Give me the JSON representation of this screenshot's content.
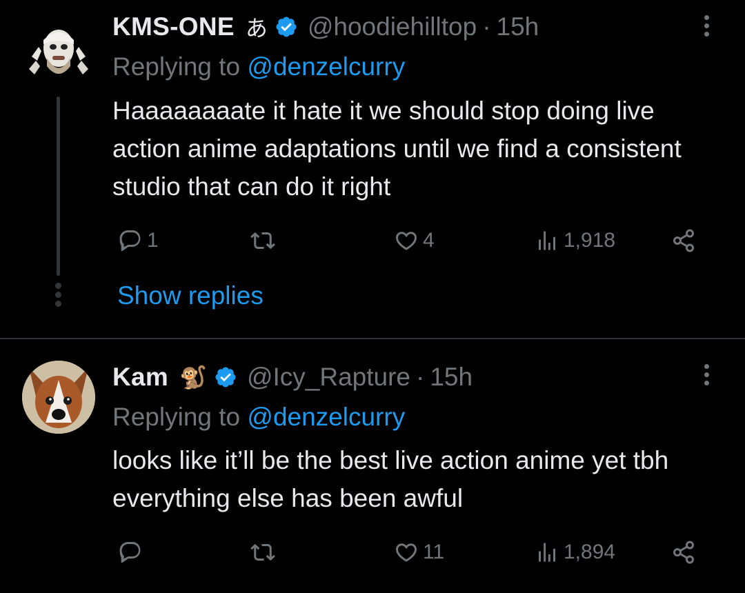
{
  "tweets": [
    {
      "name": "KMS-ONE",
      "name_emoji": "あ",
      "handle": "@hoodiehilltop",
      "separator": "·",
      "time": "15h",
      "replying_prefix": "Replying to ",
      "replying_mention": "@denzelcurry",
      "text": "Haaaaaaaate it hate it we should stop doing live action anime adaptations until we find a consistent studio that can do it right",
      "reply_count": "1",
      "retweet_count": "",
      "like_count": "4",
      "view_count": "1,918",
      "show_replies": "Show replies"
    },
    {
      "name": "Kam",
      "name_emoji": "🐒",
      "handle": "@Icy_Rapture",
      "separator": "·",
      "time": "15h",
      "replying_prefix": "Replying to ",
      "replying_mention": "@denzelcurry",
      "text": "looks like it’ll be the best live action anime yet tbh everything else has been awful",
      "reply_count": "",
      "retweet_count": "",
      "like_count": "11",
      "view_count": "1,894"
    }
  ],
  "icons": {
    "verified": "verified-badge-icon",
    "more": "more-options-icon",
    "reply": "reply-icon",
    "retweet": "retweet-icon",
    "like": "heart-icon",
    "views": "views-icon",
    "share": "share-icon"
  },
  "colors": {
    "background": "#000000",
    "text": "#e7e9ea",
    "secondary": "#71767b",
    "accent": "#1d9bf0",
    "divider": "#2f3336"
  }
}
